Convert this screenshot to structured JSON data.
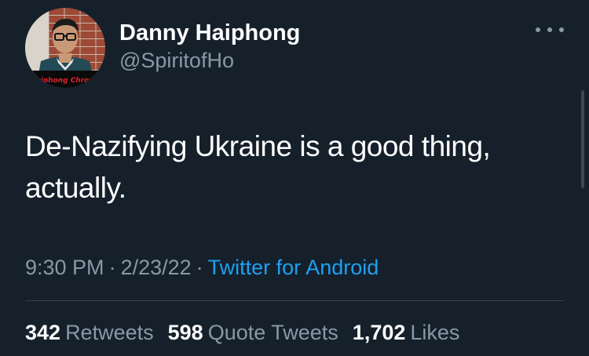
{
  "tweet": {
    "author": {
      "name": "Danny Haiphong",
      "handle": "@SpiritofHo",
      "avatar_banner_text": "Haiphong Chronicl"
    },
    "text_line1": "De-Nazifying Ukraine is a good thing,",
    "text_line2": "actually.",
    "time": "9:30 PM",
    "date": "2/23/22",
    "separator": "·",
    "source": "Twitter for Android",
    "stats": {
      "retweets_count": "342",
      "retweets_label": "Retweets",
      "quote_count": "598",
      "quote_label": "Quote Tweets",
      "likes_count": "1,702",
      "likes_label": "Likes"
    }
  },
  "colors": {
    "background": "#15202b",
    "text_primary": "#ffffff",
    "text_secondary": "#8899a6",
    "link": "#1da1f2",
    "divider": "#38444d"
  },
  "icons": {
    "more": "more-horizontal-icon"
  }
}
